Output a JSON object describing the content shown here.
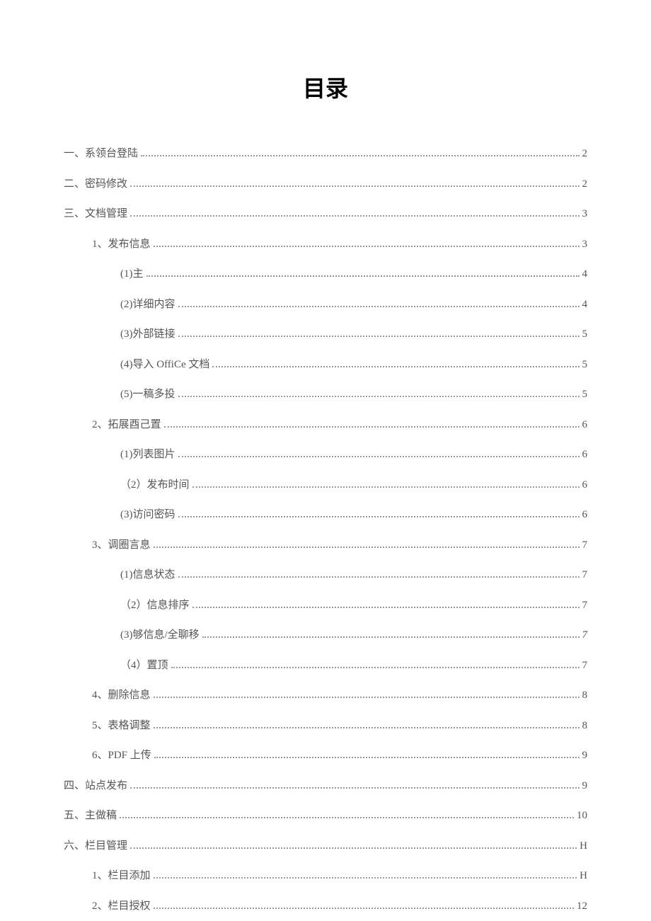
{
  "title": "目录",
  "entries": [
    {
      "label": "一、系领台登陆",
      "page": "2",
      "indent": 0
    },
    {
      "label": "二、密码修改",
      "page": "2",
      "indent": 0
    },
    {
      "label": "三、文档管理",
      "page": "3",
      "indent": 0
    },
    {
      "label": "1、发布信息",
      "page": "3",
      "indent": 1
    },
    {
      "label": "(1)主",
      "page": "4",
      "indent": 2
    },
    {
      "label": "(2)详细内容",
      "page": "4",
      "indent": 2
    },
    {
      "label": "(3)外部链接",
      "page": "5",
      "indent": 2
    },
    {
      "label": "(4)导入 OffiCe 文档",
      "page": "5",
      "indent": 2
    },
    {
      "label": "(5)一稿多投",
      "page": "5",
      "indent": 2
    },
    {
      "label": "2、拓展酉己置",
      "page": "6",
      "indent": 1
    },
    {
      "label": "(1)列表图片",
      "page": "6",
      "indent": 2
    },
    {
      "label": "（2）发布时间",
      "page": "6",
      "indent": 2
    },
    {
      "label": "(3)访问密码",
      "page": "6",
      "indent": 2
    },
    {
      "label": "3、调圈言息",
      "page": "7",
      "indent": 1
    },
    {
      "label": "(1)信息状态",
      "page": "7",
      "indent": 2
    },
    {
      "label": "（2）信息排序",
      "page": "7",
      "indent": 2
    },
    {
      "label": "(3)够信息/全聊移",
      "page": "7",
      "indent": 2,
      "italic": true
    },
    {
      "label": "（4）置顶",
      "page": "7",
      "indent": 2
    },
    {
      "label": "4、删除信息",
      "page": "8",
      "indent": 1
    },
    {
      "label": "5、表格调整",
      "page": "8",
      "indent": 1
    },
    {
      "label": "6、PDF 上传",
      "page": "9",
      "indent": 1
    },
    {
      "label": "四、站点发布",
      "page": "9",
      "indent": 0
    },
    {
      "label": "五、主做稿",
      "page": "10",
      "indent": 0
    },
    {
      "label": "六、栏目管理",
      "page": "H",
      "indent": 0
    },
    {
      "label": "1、栏目添加",
      "page": "H",
      "indent": 1
    },
    {
      "label": "2、栏目授权",
      "page": "12",
      "indent": 1
    }
  ]
}
